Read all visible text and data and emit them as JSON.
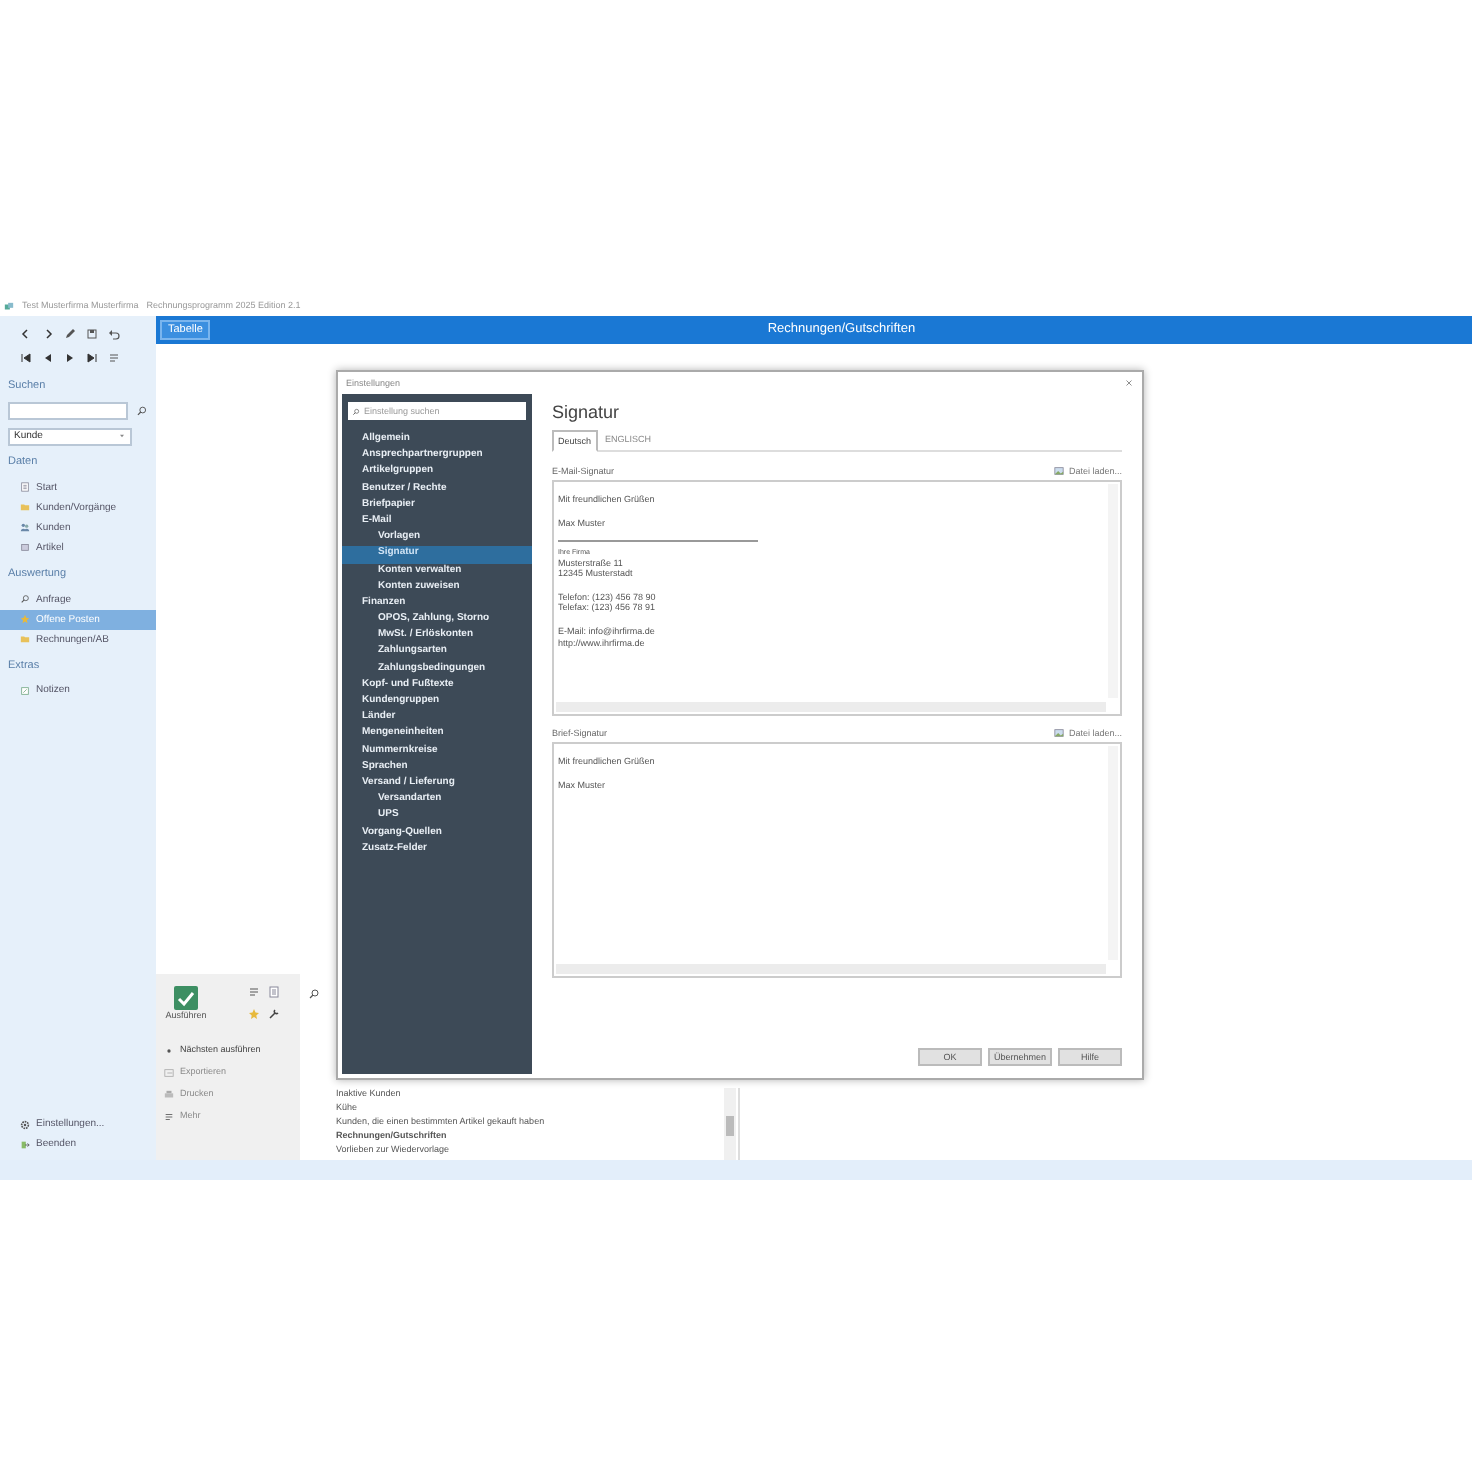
{
  "window": {
    "title": "Test Musterfirma Musterfirma",
    "subtitle": "Rechnungsprogramm 2025 Edition 2.1"
  },
  "header": {
    "tab": "Tabelle",
    "title": "Rechnungen/Gutschriften"
  },
  "sidebar": {
    "search_label": "Suchen",
    "search_scope": "Kunde",
    "sections": [
      {
        "title": "Daten",
        "items": [
          {
            "label": "Start",
            "selected": false
          },
          {
            "label": "Kunden/Vorgänge",
            "selected": false
          },
          {
            "label": "Kunden",
            "selected": false
          },
          {
            "label": "Artikel",
            "selected": false
          }
        ]
      },
      {
        "title": "Auswertung",
        "items": [
          {
            "label": "Anfrage",
            "selected": false
          },
          {
            "label": "Offene Posten",
            "selected": true
          },
          {
            "label": "Rechnungen/AB",
            "selected": false
          }
        ]
      },
      {
        "title": "Extras",
        "items": [
          {
            "label": "Notizen",
            "selected": false
          }
        ]
      }
    ],
    "footer_items": [
      "Einstellungen...",
      "Beenden"
    ]
  },
  "actions": {
    "run_button": "Ausführen",
    "items": [
      {
        "label": "Nächsten ausführen",
        "disabled": false
      },
      {
        "label": "Exportieren",
        "disabled": true
      },
      {
        "label": "Drucken",
        "disabled": true
      },
      {
        "label": "Mehr",
        "disabled": true
      }
    ]
  },
  "list": {
    "items": [
      {
        "label": "Inaktive Kunden",
        "bold": false
      },
      {
        "label": "Kühe",
        "bold": false
      },
      {
        "label": "Kunden, die einen bestimmten Artikel gekauft haben",
        "bold": false
      },
      {
        "label": "Rechnungen/Gutschriften",
        "bold": true
      },
      {
        "label": "Vorlieben zur Wiedervorlage",
        "bold": false
      }
    ]
  },
  "dialog": {
    "title": "Einstellungen",
    "search_placeholder": "Einstellung suchen",
    "nav": [
      {
        "label": "Allgemein",
        "selected": false
      },
      {
        "label": "Ansprechpartnergruppen",
        "selected": false
      },
      {
        "label": "Artikelgruppen",
        "selected": false
      },
      {
        "label": "Benutzer / Rechte",
        "selected": false
      },
      {
        "label": "Briefpapier",
        "selected": false
      },
      {
        "label": "E-Mail",
        "selected": false,
        "children": [
          {
            "label": "Vorlagen",
            "selected": false
          },
          {
            "label": "Signatur",
            "selected": true
          },
          {
            "label": "Konten verwalten",
            "selected": false
          },
          {
            "label": "Konten zuweisen",
            "selected": false
          }
        ]
      },
      {
        "label": "Finanzen",
        "selected": false,
        "children": [
          {
            "label": "OPOS, Zahlung, Storno",
            "selected": false
          },
          {
            "label": "MwSt. / Erlöskonten",
            "selected": false
          },
          {
            "label": "Zahlungsarten",
            "selected": false
          },
          {
            "label": "Zahlungsbedingungen",
            "selected": false
          }
        ]
      },
      {
        "label": "Kopf- und Fußtexte",
        "selected": false
      },
      {
        "label": "Kundengruppen",
        "selected": false
      },
      {
        "label": "Länder",
        "selected": false
      },
      {
        "label": "Mengeneinheiten",
        "selected": false
      },
      {
        "label": "Nummernkreise",
        "selected": false
      },
      {
        "label": "Sprachen",
        "selected": false
      },
      {
        "label": "Versand / Lieferung",
        "selected": false,
        "children": [
          {
            "label": "Versandarten",
            "selected": false
          },
          {
            "label": "UPS",
            "selected": false
          }
        ]
      },
      {
        "label": "Vorgang-Quellen",
        "selected": false
      },
      {
        "label": "Zusatz-Felder",
        "selected": false
      }
    ],
    "heading": "Signatur",
    "tabs": [
      {
        "label": "Deutsch",
        "selected": true
      },
      {
        "label": "ENGLISCH",
        "selected": false
      }
    ],
    "sections": [
      {
        "label": "E-Mail-Signatur",
        "load_button": "Datei laden...",
        "blocks": [
          {
            "kind": "text",
            "lines": [
              "Mit freundlichen Grüßen"
            ]
          },
          {
            "kind": "text",
            "lines": [
              "Max Muster"
            ]
          },
          {
            "kind": "rule"
          },
          {
            "kind": "caption",
            "lines": [
              "Ihre Firma"
            ]
          },
          {
            "kind": "tight",
            "lines": [
              "Musterstraße 11",
              "12345 Musterstadt"
            ]
          },
          {
            "kind": "text",
            "lines": [
              "Telefon: (123) 456 78 90",
              "Telefax: (123) 456 78 91"
            ]
          },
          {
            "kind": "text",
            "lines": [
              "E-Mail: info@ihrfirma.de",
              "http://www.ihrfirma.de"
            ]
          }
        ]
      },
      {
        "label": "Brief-Signatur",
        "load_button": "Datei laden...",
        "blocks": [
          {
            "kind": "text",
            "lines": [
              "Mit freundlichen Grüßen"
            ]
          },
          {
            "kind": "text",
            "lines": [
              "Max Muster"
            ]
          }
        ]
      }
    ],
    "buttons": [
      "OK",
      "Übernehmen",
      "Hilfe"
    ]
  }
}
